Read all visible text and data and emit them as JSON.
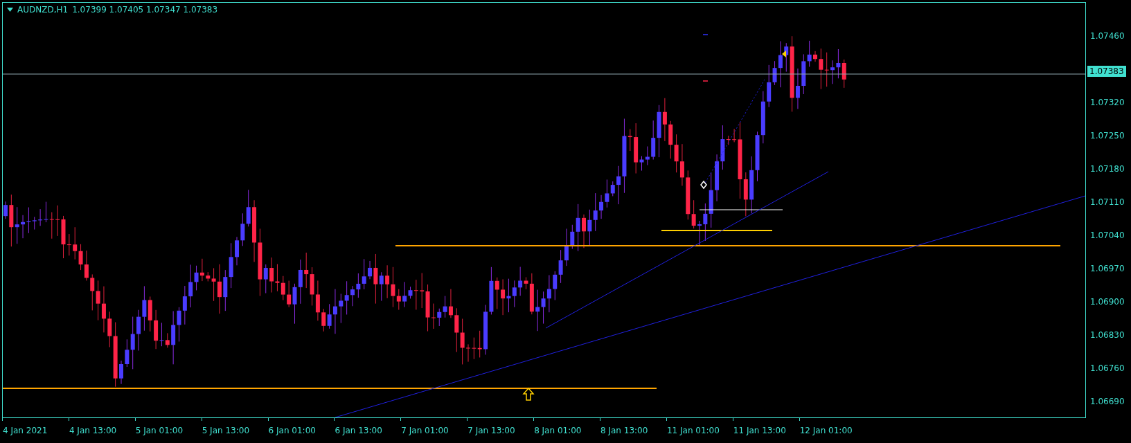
{
  "header": {
    "symbol": "AUDNZD,H1",
    "quotes": "1.07399 1.07405 1.07347 1.07383"
  },
  "price_axis": [
    {
      "kind": "tick",
      "text": "1.07460"
    },
    {
      "kind": "current",
      "text": "1.07383"
    },
    {
      "kind": "tick",
      "text": "1.07320"
    },
    {
      "kind": "tick",
      "text": "1.07250"
    },
    {
      "kind": "tick",
      "text": "1.07180"
    },
    {
      "kind": "tick",
      "text": "1.07110"
    },
    {
      "kind": "tick",
      "text": "1.07040"
    },
    {
      "kind": "tick",
      "text": "1.06970"
    },
    {
      "kind": "tick",
      "text": "1.06900"
    },
    {
      "kind": "tick",
      "text": "1.06830"
    },
    {
      "kind": "tick",
      "text": "1.06760"
    },
    {
      "kind": "tick",
      "text": "1.06690"
    }
  ],
  "time_axis": [
    "4 Jan 2021",
    "4 Jan 13:00",
    "5 Jan 01:00",
    "5 Jan 13:00",
    "6 Jan 01:00",
    "6 Jan 13:00",
    "7 Jan 01:00",
    "7 Jan 13:00",
    "8 Jan 01:00",
    "8 Jan 13:00",
    "11 Jan 01:00",
    "11 Jan 13:00",
    "12 Jan 01:00"
  ]
}
